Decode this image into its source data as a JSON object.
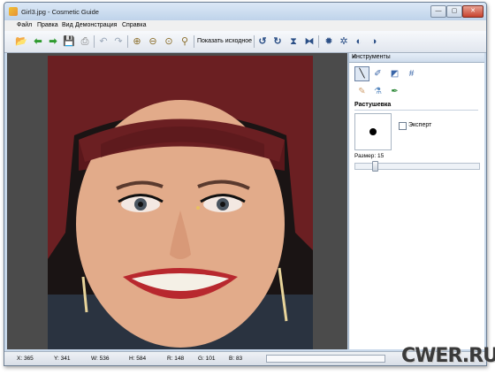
{
  "window": {
    "title": "Girl3.jpg - Cosmetic Guide",
    "controls": {
      "minimize": "—",
      "maximize": "▢",
      "close": "✕"
    }
  },
  "menu": [
    "Файл",
    "Правка",
    "Вид",
    "Демонстрация",
    "Справка"
  ],
  "toolbar": {
    "show_original": "Показать исходное",
    "icons": [
      "open-icon",
      "back-icon",
      "forward-icon",
      "save-icon",
      "print-icon",
      "undo-icon",
      "redo-icon",
      "zoom-in-icon",
      "zoom-out-icon",
      "zoom-fit-icon",
      "zoom-actual-icon",
      "rotate-left-icon",
      "rotate-right-icon",
      "flip-vertical-icon",
      "flip-horizontal-icon",
      "brightness-icon",
      "contrast-icon",
      "saturation-icon",
      "color-icon"
    ]
  },
  "panel": {
    "title": "Инструменты",
    "close": "×",
    "tools": [
      "brush-tool-icon",
      "dropper-tool-icon",
      "crop-tool-icon",
      "grid-tool-icon",
      "eraser-tool-icon",
      "bottle-tool-icon",
      "pen-tool-icon"
    ],
    "section": "Растушевка",
    "expert_label": "Эксперт",
    "expert_checked": false,
    "size_label": "Размер: 15",
    "size_value": 15
  },
  "status": {
    "x": "X: 365",
    "y": "Y: 341",
    "w": "W: 536",
    "h": "H: 584",
    "r": "R: 148",
    "g": "G: 101",
    "b": "B: 83"
  },
  "watermark": {
    "text": "CWER.RU"
  },
  "colors": {
    "canvas_bg": "#4b4b4b",
    "hair": "#6b1f22",
    "lips": "#b8282e",
    "skin": "#e2ab8a"
  }
}
